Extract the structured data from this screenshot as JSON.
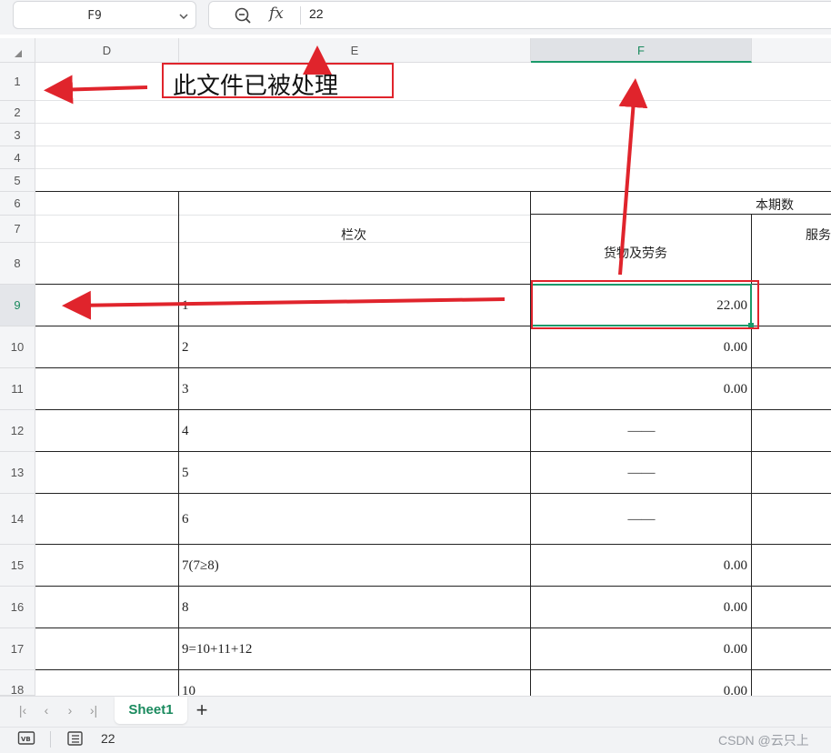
{
  "formula_bar": {
    "name_box": "F9",
    "fx_label": "fx",
    "value": "22"
  },
  "columns": [
    {
      "label": "D"
    },
    {
      "label": "E"
    },
    {
      "label": "F",
      "selected": true
    }
  ],
  "rows": [
    "1",
    "2",
    "3",
    "4",
    "5",
    "6",
    "7",
    "8",
    "9",
    "10",
    "11",
    "12",
    "13",
    "14",
    "15",
    "16",
    "17",
    "18"
  ],
  "selected_row": "9",
  "annotation": {
    "text": "此文件已被处理",
    "color": "#e0242c"
  },
  "table": {
    "header_period": "本期数",
    "header_column": "栏次",
    "header_goods": "货物及劳务",
    "header_services": "服务",
    "rows": [
      {
        "e": "1",
        "f": "22.00"
      },
      {
        "e": "2",
        "f": "0.00"
      },
      {
        "e": "3",
        "f": "0.00"
      },
      {
        "e": "4",
        "f": "——"
      },
      {
        "e": "5",
        "f": "——"
      },
      {
        "e": "6",
        "f": "——"
      },
      {
        "e": "7(7≥8)",
        "f": "0.00"
      },
      {
        "e": "8",
        "f": "0.00"
      },
      {
        "e": "9=10+11+12",
        "f": "0.00"
      },
      {
        "e": "10",
        "f": "0.00"
      }
    ]
  },
  "sheets": [
    {
      "label": "Sheet1",
      "active": true
    }
  ],
  "add_sheet_label": "+",
  "nav": {
    "first": "|‹",
    "prev": "‹",
    "next": "›",
    "last": "›|"
  },
  "status": {
    "value": "22"
  },
  "watermark": "CSDN @云只上",
  "colors": {
    "accent": "#1a8a5e",
    "selection": "#1a9a6a",
    "annotation": "#e0242c"
  }
}
